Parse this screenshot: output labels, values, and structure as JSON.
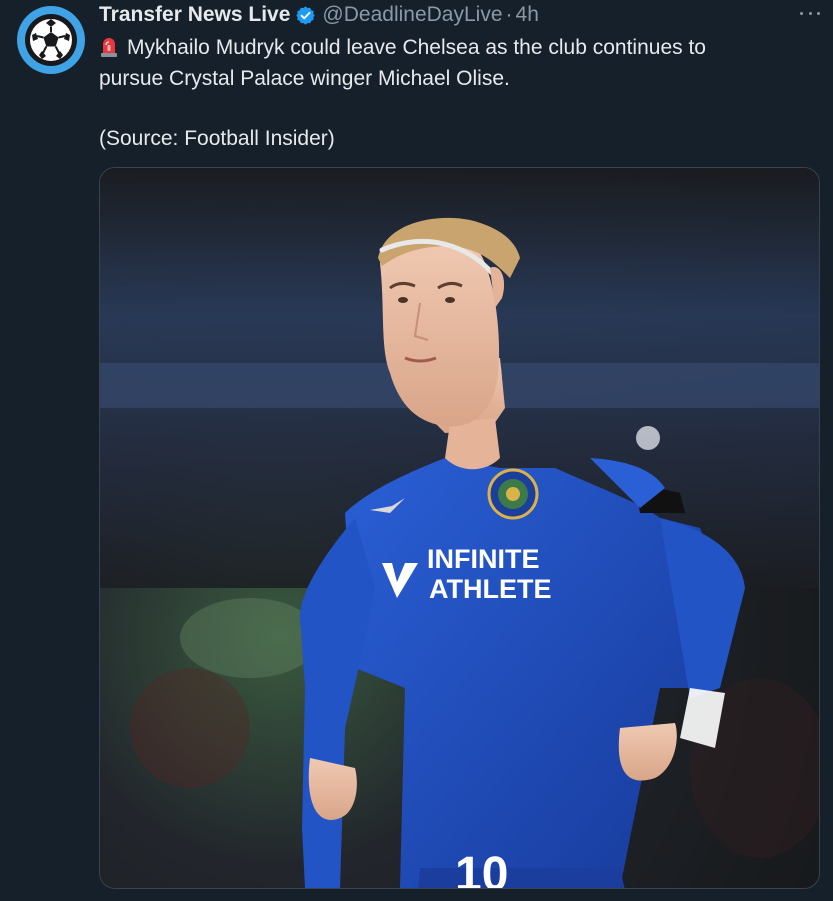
{
  "tweet": {
    "author_name": "Transfer News Live",
    "handle": "@DeadlineDayLive",
    "separator": "·",
    "time": "4h",
    "text_line1": "Mykhailo Mudryk could leave Chelsea as the club continues to",
    "text_line2": "pursue Crystal Palace winger Michael Olise.",
    "source_line": "(Source: Football Insider)"
  },
  "media": {
    "shirt_sponsor_line1": "INFINITE",
    "shirt_sponsor_line2": "ATHLETE",
    "shirt_number": "10"
  },
  "icons": {
    "avatar": "soccer-ball-icon",
    "verified": "verified-badge-icon",
    "emoji": "siren-icon",
    "menu": "more-options-icon"
  },
  "colors": {
    "background": "#15202b",
    "text": "#e7e9ea",
    "secondary": "#8b98a5",
    "accent": "#1d9bf0",
    "avatar_ring": "#3fa3e6",
    "kit_blue": "#1f4fbf"
  }
}
